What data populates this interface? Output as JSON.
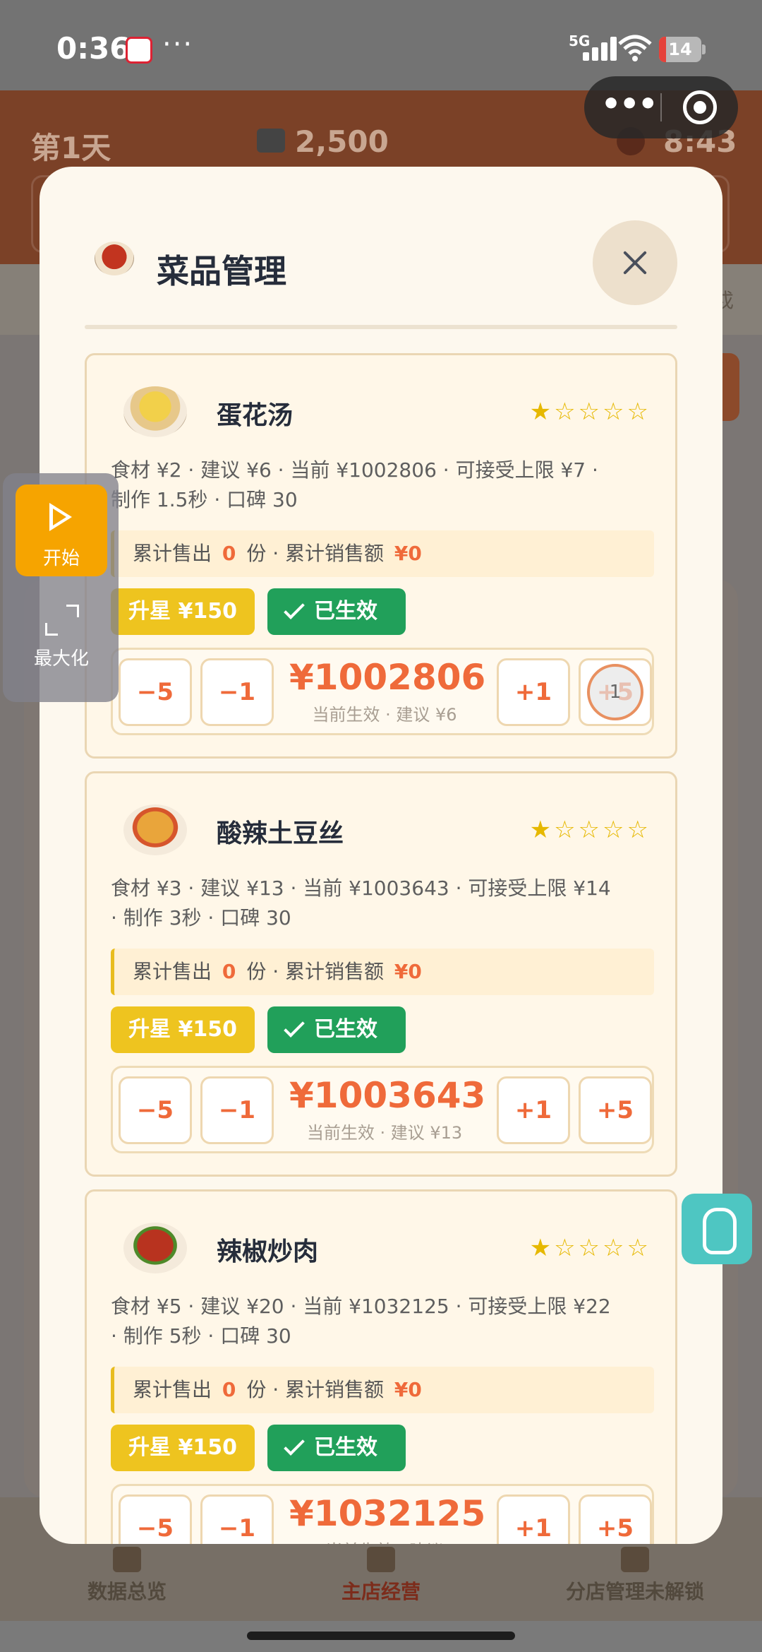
{
  "status_bar": {
    "time": "0:36",
    "dots": "···",
    "network": "5G",
    "battery": "14"
  },
  "game": {
    "day": "第1天",
    "money": "2,500",
    "clock": "8:43",
    "side_label": "戍"
  },
  "capsule": {
    "more_icon": "more-dots-icon",
    "close_icon": "target-close-icon"
  },
  "float_panel": {
    "start_label": "开始",
    "maximize_label": "最大化"
  },
  "modal": {
    "title": "菜品管理",
    "dishes": [
      {
        "name": "蛋花汤",
        "stars": "★☆☆☆☆",
        "info_line1": "食材 ¥2 · 建议 ¥6 · 当前 ¥1002806 · 可接受上限 ¥7 ·",
        "info_line2": "制作 1.5秒 · 口碑 30",
        "sold_prefix": "累计售出",
        "sold_count": "0",
        "sold_mid": "份 · 累计销售额",
        "sales_amount": "¥0",
        "upgrade_label": "升星 ¥150",
        "active_label": "已生效",
        "minus5": "−5",
        "minus1": "−1",
        "price": "¥1002806",
        "price_note": "当前生效 · 建议 ¥6",
        "plus1": "+1",
        "plus5": "+5",
        "cursor_badge": "1"
      },
      {
        "name": "酸辣土豆丝",
        "stars": "★☆☆☆☆",
        "info_line1": "食材 ¥3 · 建议 ¥13 · 当前 ¥1003643 · 可接受上限 ¥14",
        "info_line2": "· 制作 3秒 · 口碑 30",
        "sold_prefix": "累计售出",
        "sold_count": "0",
        "sold_mid": "份 · 累计销售额",
        "sales_amount": "¥0",
        "upgrade_label": "升星 ¥150",
        "active_label": "已生效",
        "minus5": "−5",
        "minus1": "−1",
        "price": "¥1003643",
        "price_note": "当前生效 · 建议 ¥13",
        "plus1": "+1",
        "plus5": "+5"
      },
      {
        "name": "辣椒炒肉",
        "stars": "★☆☆☆☆",
        "info_line1": "食材 ¥5 · 建议 ¥20 · 当前 ¥1032125 · 可接受上限 ¥22",
        "info_line2": "· 制作 5秒 · 口碑 30",
        "sold_prefix": "累计售出",
        "sold_count": "0",
        "sold_mid": "份 · 累计销售额",
        "sales_amount": "¥0",
        "upgrade_label": "升星 ¥150",
        "active_label": "已生效",
        "minus5": "−5",
        "minus1": "−1",
        "price": "¥1032125",
        "price_note": "当前生效 · 建议",
        "plus1": "+1",
        "plus5": "+5"
      }
    ]
  },
  "bottom_nav": {
    "items": [
      "数据总览",
      "主店经营",
      "分店管理未解锁"
    ],
    "active": "主店经营"
  },
  "colors": {
    "accent_orange": "#ef6a3a",
    "upgrade_yellow": "#eec41f",
    "active_green": "#21a05a",
    "start_orange": "#f6a400"
  }
}
